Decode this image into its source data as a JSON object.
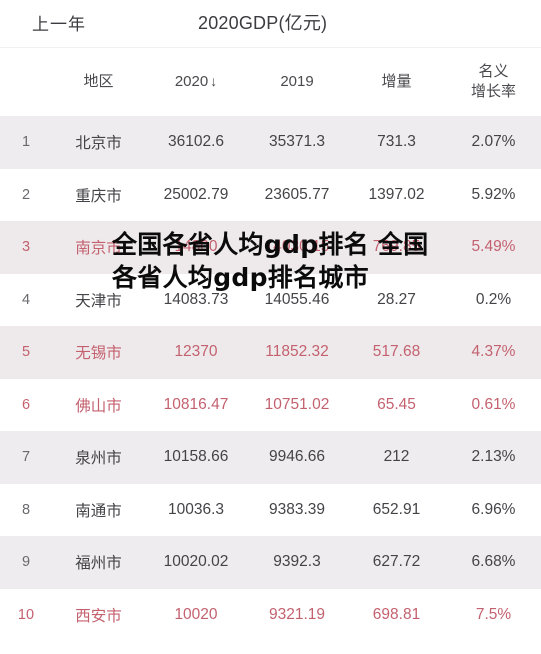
{
  "topbar": {
    "left_label": "上一年",
    "title": "2020GDP(亿元)"
  },
  "table": {
    "columns": [
      {
        "key": "rank",
        "label": ""
      },
      {
        "key": "area",
        "label": "地区"
      },
      {
        "key": "y2020",
        "label": "2020",
        "sort_indicator": "↓"
      },
      {
        "key": "y2019",
        "label": "2019"
      },
      {
        "key": "inc",
        "label": "增量"
      },
      {
        "key": "rate",
        "label_line1": "名义",
        "label_line2": "增长率"
      }
    ],
    "rows": [
      {
        "rank": "1",
        "area": "北京市",
        "y2020": "36102.6",
        "y2019": "35371.3",
        "inc": "731.3",
        "rate": "2.07%",
        "highlight": false,
        "stripe": true
      },
      {
        "rank": "2",
        "area": "重庆市",
        "y2020": "25002.79",
        "y2019": "23605.77",
        "inc": "1397.02",
        "rate": "5.92%",
        "highlight": false,
        "stripe": false
      },
      {
        "rank": "3",
        "area": "南京市",
        "y2020": "14800",
        "y2019": "14030.15",
        "inc": "769.85",
        "rate": "5.49%",
        "highlight": true,
        "stripe": true
      },
      {
        "rank": "4",
        "area": "天津市",
        "y2020": "14083.73",
        "y2019": "14055.46",
        "inc": "28.27",
        "rate": "0.2%",
        "highlight": false,
        "stripe": false
      },
      {
        "rank": "5",
        "area": "无锡市",
        "y2020": "12370",
        "y2019": "11852.32",
        "inc": "517.68",
        "rate": "4.37%",
        "highlight": true,
        "stripe": true
      },
      {
        "rank": "6",
        "area": "佛山市",
        "y2020": "10816.47",
        "y2019": "10751.02",
        "inc": "65.45",
        "rate": "0.61%",
        "highlight": true,
        "stripe": false
      },
      {
        "rank": "7",
        "area": "泉州市",
        "y2020": "10158.66",
        "y2019": "9946.66",
        "inc": "212",
        "rate": "2.13%",
        "highlight": false,
        "stripe": true
      },
      {
        "rank": "8",
        "area": "南通市",
        "y2020": "10036.3",
        "y2019": "9383.39",
        "inc": "652.91",
        "rate": "6.96%",
        "highlight": false,
        "stripe": false
      },
      {
        "rank": "9",
        "area": "福州市",
        "y2020": "10020.02",
        "y2019": "9392.3",
        "inc": "627.72",
        "rate": "6.68%",
        "highlight": false,
        "stripe": true
      },
      {
        "rank": "10",
        "area": "西安市",
        "y2020": "10020",
        "y2019": "9321.19",
        "inc": "698.81",
        "rate": "7.5%",
        "highlight": true,
        "stripe": false
      }
    ]
  },
  "overlay": {
    "text": "全国各省人均gdp排名 全国各省人均gdp排名城市"
  },
  "colors": {
    "highlight_text": "#c4616f",
    "normal_text": "#444448",
    "stripe_bg": "#eeecee",
    "plain_bg": "#ffffff"
  }
}
